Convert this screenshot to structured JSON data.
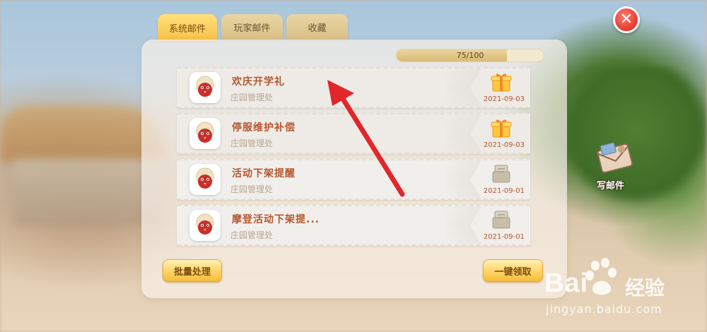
{
  "tabs": [
    {
      "label": "系统邮件",
      "active": true
    },
    {
      "label": "玩家邮件",
      "active": false
    },
    {
      "label": "收藏",
      "active": false
    }
  ],
  "capacity": {
    "text": "75/100",
    "fraction": 0.75
  },
  "mails": [
    {
      "title": "欢庆开学礼",
      "sender": "庄园管理处",
      "date": "2021-09-03",
      "icon": "gift-icon"
    },
    {
      "title": "停服维护补偿",
      "sender": "庄园管理处",
      "date": "2021-09-03",
      "icon": "gift-icon"
    },
    {
      "title": "活动下架提醒",
      "sender": "庄园管理处",
      "date": "2021-09-01",
      "icon": "letter-icon"
    },
    {
      "title": "摩登活动下架提...",
      "sender": "庄园管理处",
      "date": "2021-09-01",
      "icon": "letter-icon"
    }
  ],
  "buttons": {
    "batch": "批量处理",
    "claim_all": "一键领取"
  },
  "write_mail": {
    "label": "写邮件",
    "icon": "envelope-icon"
  },
  "close": {
    "icon": "close-icon",
    "glyph": "✕"
  },
  "watermark": {
    "main": "Bai",
    "cn": "经验",
    "url": "jingyan.baidu.com"
  },
  "colors": {
    "title": "#b5562e",
    "accent": "#f6c14a",
    "close": "#e5392f",
    "annotation": "#e3262b"
  }
}
